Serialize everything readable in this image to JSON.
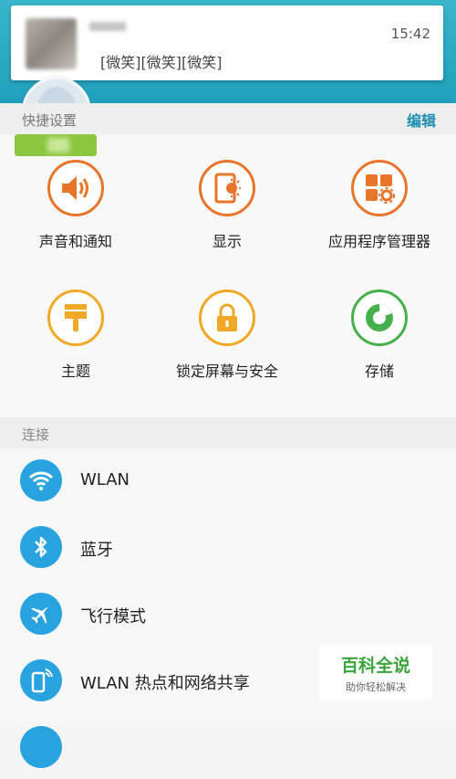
{
  "notification": {
    "message": "[微笑][微笑][微笑]",
    "time": "15:42"
  },
  "quick_settings": {
    "title": "快捷设置",
    "edit_label": "编辑"
  },
  "grid": {
    "sound": "声音和通知",
    "display": "显示",
    "apps": "应用程序管理器",
    "themes": "主题",
    "lock": "锁定屏幕与安全",
    "storage": "存储"
  },
  "connections": {
    "title": "连接",
    "items": [
      "WLAN",
      "蓝牙",
      "飞行模式",
      "WLAN 热点和网络共享"
    ]
  },
  "colors": {
    "header": "#20a0bc",
    "orange": "#e8752a",
    "yellow": "#f0a826",
    "green": "#46b04a",
    "blue": "#29a3e0"
  },
  "watermark": {
    "title": "百科全说",
    "subtitle": "助你轻松解决"
  }
}
